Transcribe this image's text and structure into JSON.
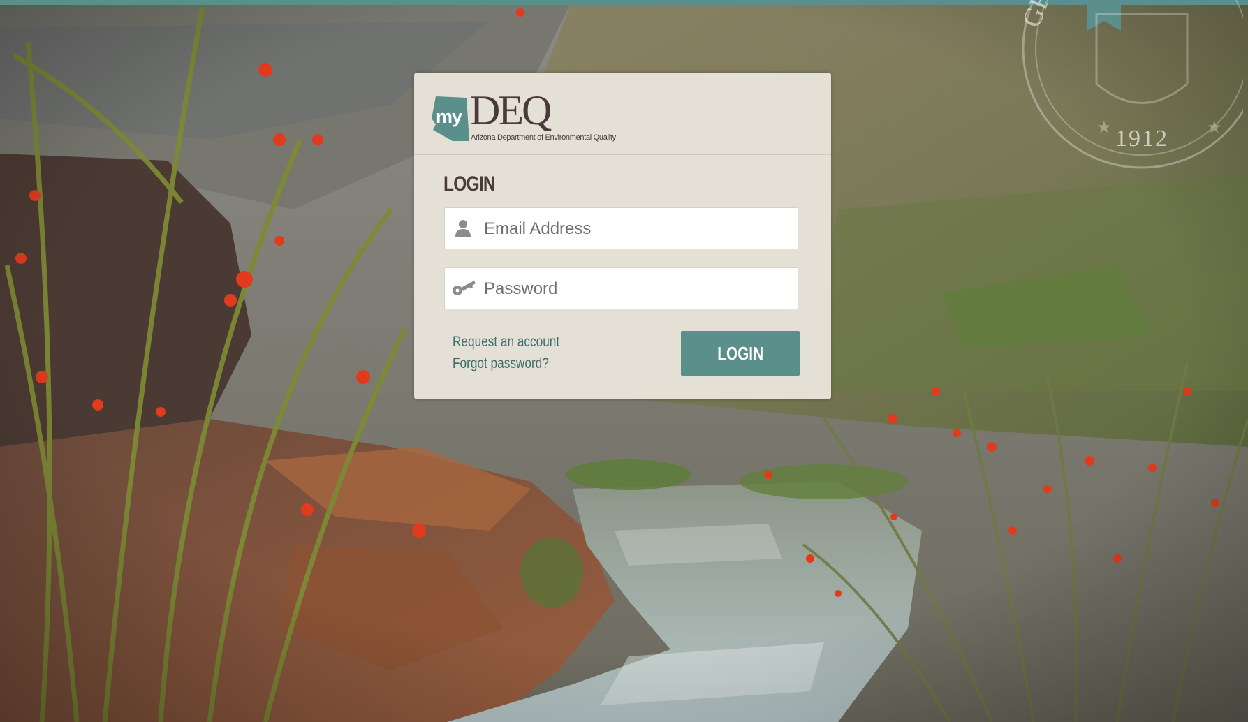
{
  "header": {
    "logo_my": "my",
    "logo_name": "DEQ",
    "logo_subtitle": "Arizona Department of Environmental Quality"
  },
  "seal": {
    "text": "GREAT S",
    "year": "1912"
  },
  "login": {
    "heading": "LOGIN",
    "email_placeholder": "Email Address",
    "password_placeholder": "Password",
    "request_account_label": "Request an account",
    "forgot_password_label": "Forgot password?",
    "submit_label": "LOGIN"
  },
  "icons": {
    "email": "user-icon",
    "password": "key-icon"
  },
  "colors": {
    "accent": "#5b8f8c",
    "card_background": "#e5e0d6",
    "heading_text": "#4a3b3a",
    "link": "#3e6d6b"
  }
}
